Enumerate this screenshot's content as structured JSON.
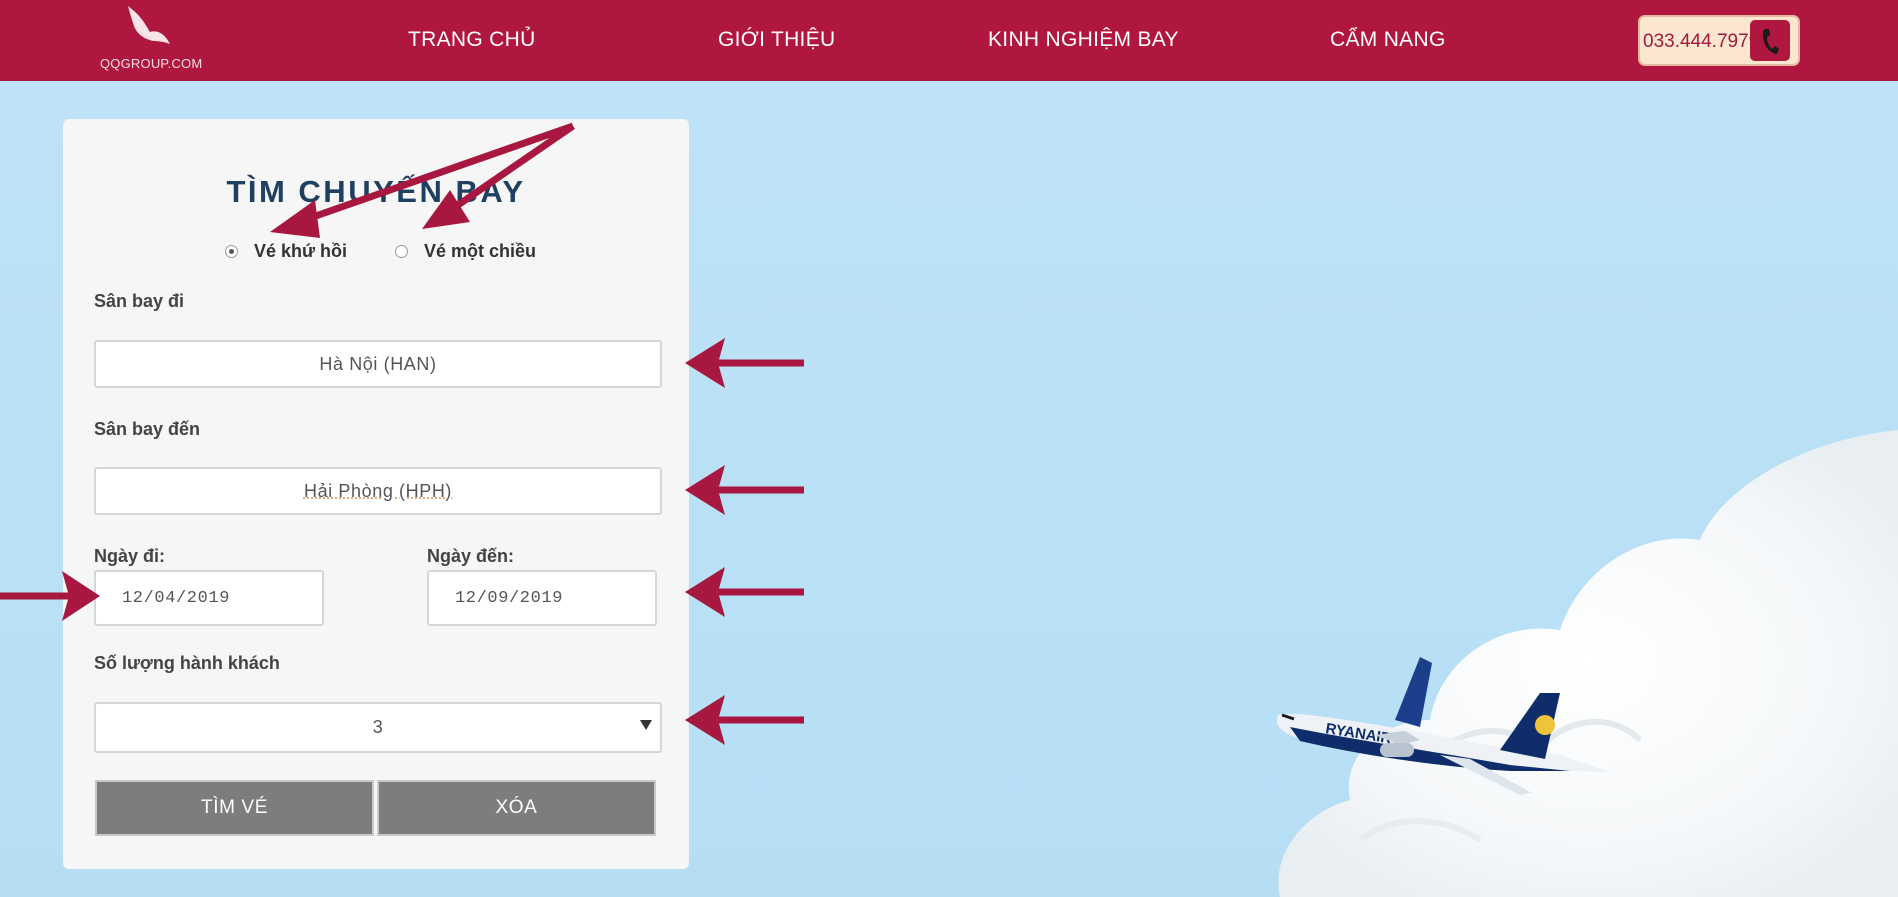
{
  "header": {
    "logo_text": "QQGROUP.COM",
    "nav": [
      "TRANG CHỦ",
      "GIỚI THIỆU",
      "KINH NGHIỆM BAY",
      "CẨM NANG"
    ],
    "phone": "033.444.7979"
  },
  "form": {
    "title": "TÌM CHUYẾN BAY",
    "trip_types": [
      {
        "label": "Vé khứ hồi",
        "selected": true
      },
      {
        "label": "Vé một chiều",
        "selected": false
      }
    ],
    "from_label": "Sân bay đi",
    "from_value": "Hà Nội (HAN)",
    "to_label": "Sân bay đến",
    "to_value": "Hải Phòng (HPH)",
    "depart_label": "Ngày đi:",
    "depart_value": "12/04/2019",
    "return_label": "Ngày đến:",
    "return_value": "12/09/2019",
    "passengers_label": "Số lượng hành khách",
    "passengers_value": "3",
    "search_button": "TÌM VÉ",
    "clear_button": "XÓA"
  },
  "colors": {
    "brand": "#b0173e",
    "annotation_arrow": "#a8173f",
    "button": "#7d7d7d"
  }
}
